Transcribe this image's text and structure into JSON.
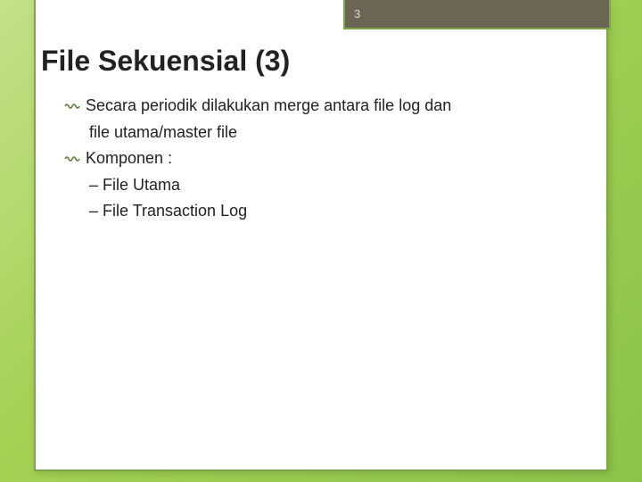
{
  "page_number": "3",
  "title": "File Sekuensial (3)",
  "bullets": [
    {
      "text": "Secara periodik dilakukan merge antara file log dan file utama/master file",
      "continuation": "file utama/master file"
    },
    {
      "text": "Komponen :",
      "subitems": [
        "– File Utama",
        "– File Transaction Log"
      ]
    }
  ],
  "lines": {
    "b1_part1": "Secara periodik dilakukan merge antara file log dan",
    "b1_part2": "file utama/master file",
    "b2": "Komponen :",
    "s1": "– File Utama",
    "s2": "– File Transaction Log"
  }
}
